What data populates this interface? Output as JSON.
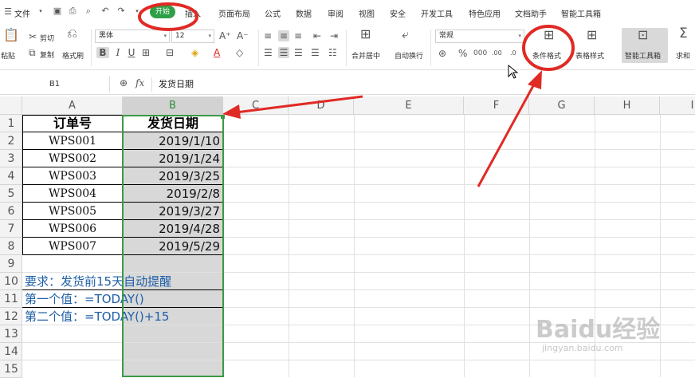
{
  "menubar": {
    "file_label": "文件",
    "tabs": [
      {
        "label": "开始"
      },
      {
        "label": "插入"
      },
      {
        "label": "页面布局"
      },
      {
        "label": "公式"
      },
      {
        "label": "数据"
      },
      {
        "label": "审阅"
      },
      {
        "label": "视图"
      },
      {
        "label": "安全"
      },
      {
        "label": "开发工具"
      },
      {
        "label": "特色应用"
      },
      {
        "label": "文档助手"
      },
      {
        "label": "智能工具箱"
      }
    ]
  },
  "ribbon": {
    "paste_label": "粘贴",
    "cut_label": "剪切",
    "copy_label": "复制",
    "format_painter_label": "格式刷",
    "font_name": "黑体",
    "font_size": "12",
    "number_format": "常规",
    "merge_center_label": "合并居中",
    "wrap_text_label": "自动换行",
    "conditional_format_label": "条件格式",
    "table_style_label": "表格样式",
    "smart_toolbox_label": "智能工具箱",
    "sum_label": "求和"
  },
  "formula_bar": {
    "name_box": "B1",
    "fx_label": "fx",
    "content": "发货日期"
  },
  "grid": {
    "columns": [
      "A",
      "B",
      "C",
      "D",
      "E",
      "F",
      "G",
      "H",
      "I"
    ],
    "selected_column": "B",
    "rows": [
      "1",
      "2",
      "3",
      "4",
      "5",
      "6",
      "7",
      "8",
      "9",
      "10",
      "11",
      "12",
      "13",
      "14",
      "15"
    ],
    "header": {
      "col_a": "订单号",
      "col_b": "发货日期"
    },
    "data": [
      {
        "id": "WPS001",
        "date": "2019/1/10"
      },
      {
        "id": "WPS002",
        "date": "2019/1/24"
      },
      {
        "id": "WPS003",
        "date": "2019/3/25"
      },
      {
        "id": "WPS004",
        "date": "2019/2/8"
      },
      {
        "id": "WPS005",
        "date": "2019/3/27"
      },
      {
        "id": "WPS006",
        "date": "2019/4/28"
      },
      {
        "id": "WPS007",
        "date": "2019/5/29"
      }
    ],
    "notes": [
      "要求：发货前15天自动提醒",
      "第一个值：=TODAY()",
      "第二个值：=TODAY()+15"
    ]
  },
  "watermark": {
    "brand": "Baidu经验",
    "url": "jingyan.baidu.com"
  },
  "colors": {
    "active_tab": "#2e9f47",
    "annotation_red": "#e02a25",
    "note_blue": "#1f5fa8",
    "selection_green": "#2e8b3a"
  }
}
